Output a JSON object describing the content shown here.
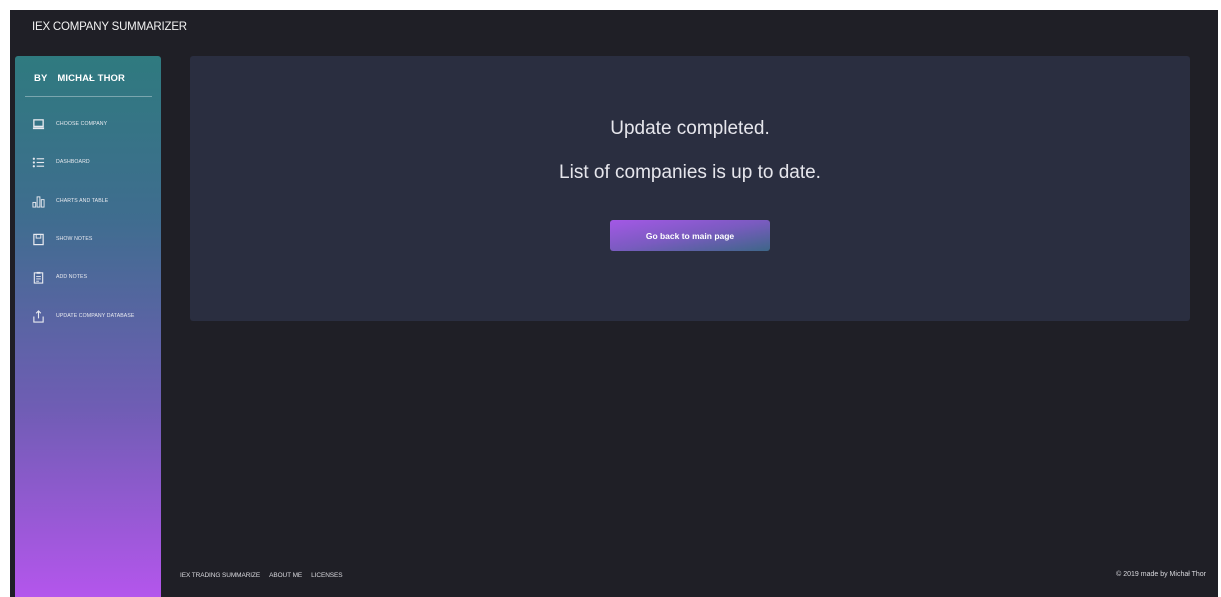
{
  "app": {
    "title": "IEX COMPANY SUMMARIZER"
  },
  "sidebar": {
    "author_prefix": "BY",
    "author_name": "MICHAŁ THOR",
    "items": [
      {
        "label": "CHOOSE COMPANY",
        "icon": "laptop-icon"
      },
      {
        "label": "DASHBOARD",
        "icon": "list-icon"
      },
      {
        "label": "CHARTS AND TABLE",
        "icon": "bar-chart-icon"
      },
      {
        "label": "SHOW NOTES",
        "icon": "notebook-icon"
      },
      {
        "label": "ADD NOTES",
        "icon": "clipboard-icon"
      },
      {
        "label": "UPDATE COMPANY DATABASE",
        "icon": "upload-icon"
      }
    ]
  },
  "main": {
    "message_line1": "Update completed.",
    "message_line2": "List of companies is up to date.",
    "back_button": "Go back to main page"
  },
  "footer": {
    "links": [
      "IEX TRADING SUMMARIZE",
      "ABOUT ME",
      "LICENSES"
    ],
    "copyright": "© 2019 made by Michał Thor"
  },
  "colors": {
    "background": "#1f1f26",
    "card": "#2a2e40",
    "sidebar_top": "#2f7a7f",
    "sidebar_bottom": "#b456ec",
    "button_start": "#a458e6",
    "button_end": "#3d6688"
  }
}
